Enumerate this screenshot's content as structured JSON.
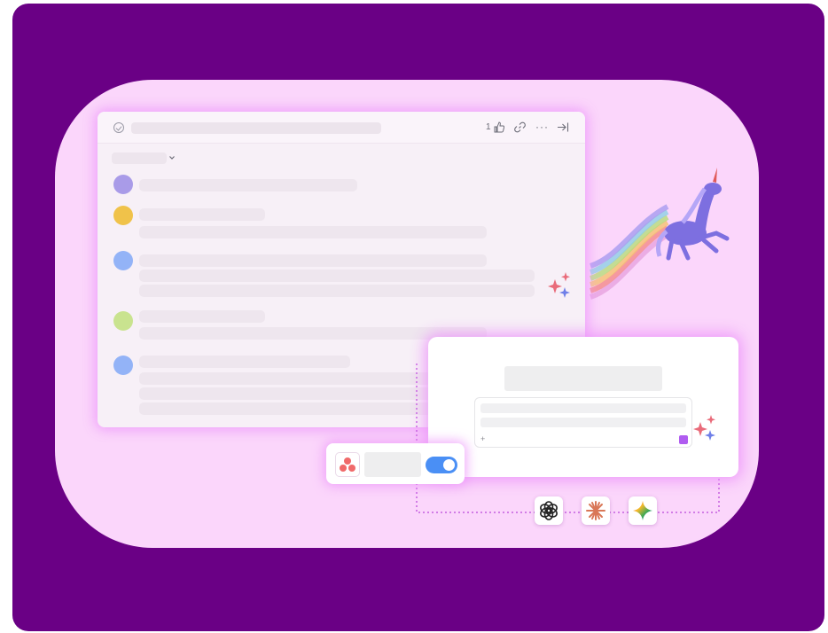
{
  "task_panel": {
    "like_count": "1",
    "icons": [
      "check-circle-icon",
      "thumbs-up-icon",
      "link-icon",
      "more-icon",
      "collapse-panel-icon",
      "chevron-down-icon"
    ],
    "more_glyph": "···",
    "comments": [
      {
        "avatar_color": "#a99be8"
      },
      {
        "avatar_color": "#f0c24a"
      },
      {
        "avatar_color": "#93b3f7"
      },
      {
        "avatar_color": "#c9e38f"
      },
      {
        "avatar_color": "#93b3f7"
      }
    ]
  },
  "ai_card": {
    "plus_glyph": "+",
    "accent": "#b05cf0"
  },
  "integration": {
    "icon": "asana-icon",
    "toggle_on": true,
    "toggle_color": "#4a8ff5"
  },
  "ai_models": [
    {
      "icon": "openai-icon"
    },
    {
      "icon": "claude-icon"
    },
    {
      "icon": "gemini-icon"
    }
  ],
  "colors": {
    "background": "#6a0085",
    "panel_bg": "#fbd6fb",
    "glow": "#ec96fa"
  }
}
